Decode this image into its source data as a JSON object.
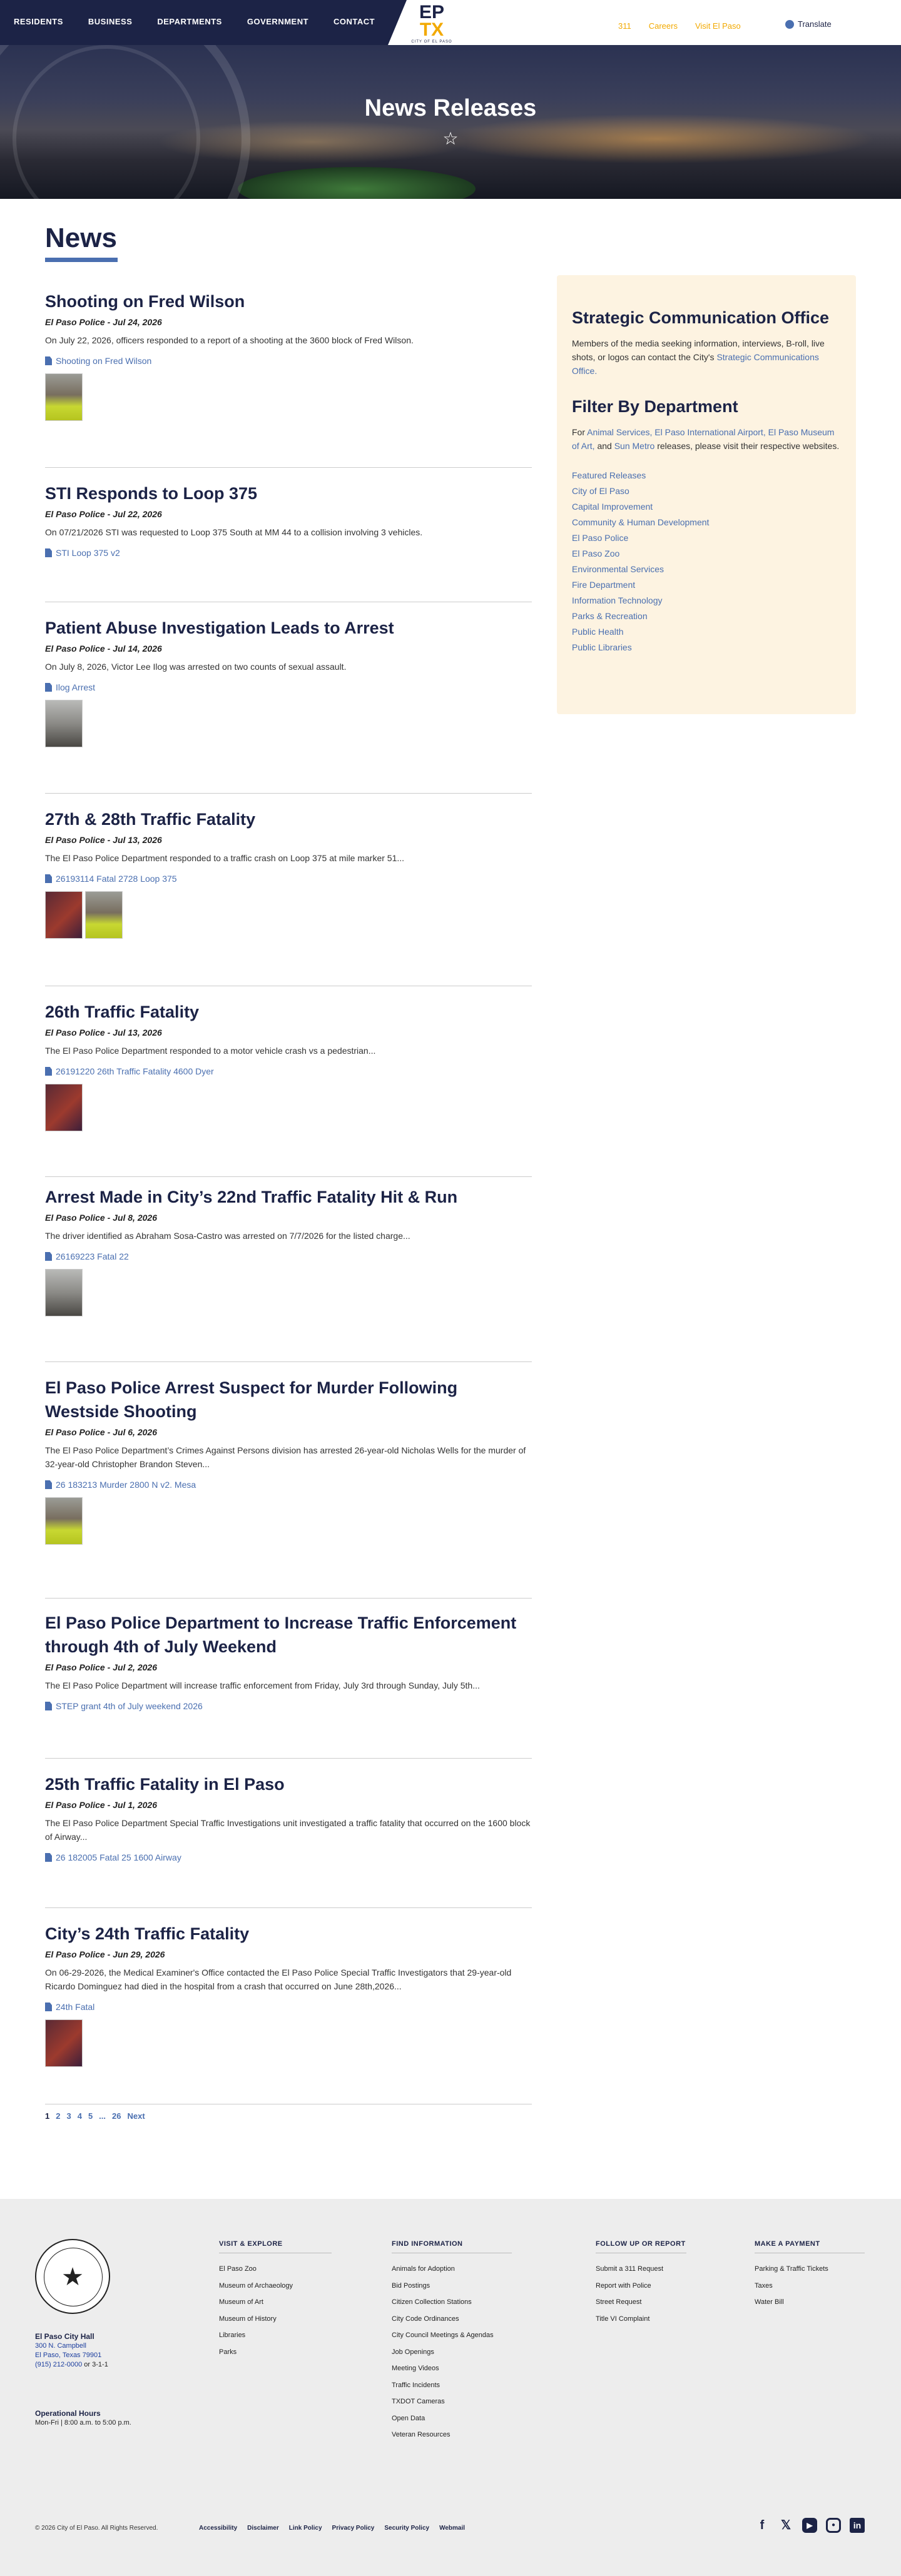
{
  "nav": {
    "items": [
      "RESIDENTS",
      "BUSINESS",
      "DEPARTMENTS",
      "GOVERNMENT",
      "CONTACT"
    ],
    "logo": {
      "ep": "EP",
      "tx": "TX",
      "tagline": "CITY OF EL PASO"
    },
    "utility": [
      "311",
      "Careers",
      "Visit El Paso"
    ],
    "translate": "Translate"
  },
  "hero": {
    "title": "News Releases"
  },
  "main": {
    "heading": "News"
  },
  "articles": [
    {
      "title": "Shooting on Fred Wilson",
      "meta": "El Paso Police - Jul 24, 2026",
      "desc": "On July 22, 2026, officers responded to a report of a shooting at the 3600 block of Fred Wilson.",
      "file": "Shooting on Fred Wilson"
    },
    {
      "title": "STI Responds to Loop 375",
      "meta": "El Paso Police - Jul 22, 2026",
      "desc": "On 07/21/2026 STI was requested to Loop 375 South at MM 44 to a collision involving 3 vehicles.",
      "file": "STI Loop 375 v2"
    },
    {
      "title": "Patient Abuse Investigation Leads to Arrest",
      "meta": "El Paso Police - Jul 14, 2026",
      "desc": "On July 8, 2026, Victor Lee Ilog was arrested on two counts of sexual assault.",
      "file": "Ilog Arrest"
    },
    {
      "title": "27th & 28th Traffic Fatality",
      "meta": "El Paso Police - Jul 13, 2026",
      "desc": "The El Paso Police Department responded to a traffic crash on Loop 375 at mile marker 51...",
      "file": "26193114 Fatal 2728 Loop 375"
    },
    {
      "title": "26th Traffic Fatality",
      "meta": "El Paso Police - Jul 13, 2026",
      "desc": "The El Paso Police Department responded to a motor vehicle crash vs a pedestrian...",
      "file": "26191220 26th Traffic Fatality 4600 Dyer"
    },
    {
      "title": "Arrest Made in City’s 22nd Traffic Fatality Hit & Run",
      "meta": "El Paso Police - Jul 8, 2026",
      "desc": "The driver identified as Abraham Sosa-Castro was arrested on 7/7/2026 for the listed charge...",
      "file": "26169223 Fatal 22"
    },
    {
      "title": "El Paso Police Arrest Suspect for Murder Following Westside Shooting",
      "meta": "El Paso Police - Jul 6, 2026",
      "desc": "The El Paso Police Department’s Crimes Against Persons division has arrested 26-year-old Nicholas Wells for the murder of 32-year-old Christopher Brandon Steven...",
      "file": "26 183213 Murder 2800 N v2. Mesa"
    },
    {
      "title": "El Paso Police Department to Increase Traffic Enforcement through 4th of July Weekend",
      "meta": "El Paso Police - Jul 2, 2026",
      "desc": "The El Paso Police Department will increase traffic enforcement from Friday, July 3rd through Sunday, July 5th...",
      "file": "STEP grant 4th of July weekend 2026"
    },
    {
      "title": "25th Traffic Fatality in El Paso",
      "meta": "El Paso Police - Jul 1, 2026",
      "desc": "The El Paso Police Department Special Traffic Investigations unit investigated a traffic fatality that occurred on the 1600 block of Airway...",
      "file": "26 182005 Fatal 25 1600 Airway"
    },
    {
      "title": "City’s 24th Traffic Fatality",
      "meta": "El Paso Police - Jun 29, 2026",
      "desc": "On 06-29-2026, the Medical Examiner's Office contacted the El Paso Police Special Traffic Investigators that 29-year-old Ricardo Dominguez had died in the hospital from a crash that occurred on June 28th,2026...",
      "file": "24th Fatal"
    }
  ],
  "sidebar": {
    "comm_title": "Strategic Communication Office",
    "comm_text": "Members of the media seeking information, interviews, B-roll, live shots, or logos can contact the City's",
    "comm_link": "Strategic Communications Office.",
    "filter_title": "Filter By Department",
    "filter_for": "For",
    "filter_links": [
      "Animal Services,",
      "El Paso International Airport,",
      "El Paso Museum of Art,",
      "Sun Metro"
    ],
    "filter_and": "and",
    "filter_tail": "releases, please visit their respective websites.",
    "departments": [
      "Featured Releases",
      "City of El Paso",
      "Capital Improvement",
      "Community & Human Development",
      "El Paso Police",
      "El Paso Zoo",
      "Environmental Services",
      "Fire Department",
      "Information Technology",
      "Parks & Recreation",
      "Public Health",
      "Public Libraries"
    ]
  },
  "pagination": {
    "current": "1",
    "pages": [
      "2",
      "3",
      "4",
      "5"
    ],
    "ellipsis": "...",
    "last": "26",
    "next": "Next"
  },
  "footer": {
    "seal_text": "THE CITY OF EL PASO TEXAS",
    "hall_title": "El Paso City Hall",
    "addr1": "300 N. Campbell",
    "addr2": "El Paso, Texas 79901",
    "phone": "(915) 212-0000",
    "phone_alt": "or 3-1-1",
    "hours_title": "Operational Hours",
    "hours": "Mon-Fri | 8:00 a.m. to 5:00 p.m.",
    "columns": [
      {
        "title": "VISIT & EXPLORE",
        "items": [
          "El Paso Zoo",
          "Museum of Archaeology",
          "Museum of Art",
          "Museum of History",
          "Libraries",
          "Parks"
        ]
      },
      {
        "title": "FIND INFORMATION",
        "items": [
          "Animals for Adoption",
          "Bid Postings",
          "Citizen Collection Stations",
          "City Code Ordinances",
          "City Council Meetings & Agendas",
          "Job Openings",
          "Meeting Videos",
          "Traffic Incidents",
          "TXDOT Cameras",
          "Open Data",
          "Veteran Resources"
        ]
      },
      {
        "title": "FOLLOW UP OR REPORT",
        "items": [
          "Submit a 311 Request",
          "Report with Police",
          "Street Request",
          "Title VI Complaint"
        ]
      },
      {
        "title": "MAKE A PAYMENT",
        "items": [
          "Parking & Traffic Tickets",
          "Taxes",
          "Water Bill"
        ]
      }
    ],
    "copyright": "© 2026 City of El Paso. All Rights Reserved.",
    "links": [
      "Accessibility",
      "Disclaimer",
      "Link Policy",
      "Privacy Policy",
      "Security Policy",
      "Webmail"
    ]
  }
}
